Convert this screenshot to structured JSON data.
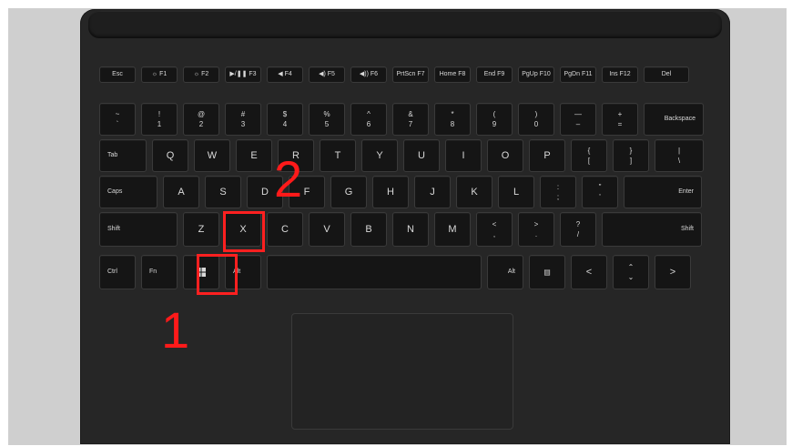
{
  "keyboard": {
    "rows": [
      [
        {
          "label": "Esc",
          "style": "fn-row",
          "w": 40
        },
        {
          "label": "☼ F1",
          "style": "fn-row",
          "w": 40
        },
        {
          "label": "☼ F2",
          "style": "fn-row",
          "w": 40
        },
        {
          "label": "▶/❚❚ F3",
          "style": "fn-row",
          "w": 40
        },
        {
          "label": "◀ F4",
          "style": "fn-row",
          "w": 40
        },
        {
          "label": "◀) F5",
          "style": "fn-row",
          "w": 40
        },
        {
          "label": "◀)) F6",
          "style": "fn-row",
          "w": 40
        },
        {
          "label": "PrtScn F7",
          "style": "fn-row",
          "w": 40
        },
        {
          "label": "Home F8",
          "style": "fn-row",
          "w": 40
        },
        {
          "label": "End F9",
          "style": "fn-row",
          "w": 40
        },
        {
          "label": "PgUp F10",
          "style": "fn-row",
          "w": 40
        },
        {
          "label": "PgDn F11",
          "style": "fn-row",
          "w": 40
        },
        {
          "label": "Ins F12",
          "style": "fn-row",
          "w": 40
        },
        {
          "label": "Del",
          "style": "fn-row",
          "w": 50
        }
      ],
      [
        {
          "label": "~\n`",
          "style": "two",
          "w": 40
        },
        {
          "label": "!\n1",
          "style": "two",
          "w": 40
        },
        {
          "label": "@\n2",
          "style": "two",
          "w": 40
        },
        {
          "label": "#\n3",
          "style": "two",
          "w": 40
        },
        {
          "label": "$\n4",
          "style": "two",
          "w": 40
        },
        {
          "label": "%\n5",
          "style": "two",
          "w": 40
        },
        {
          "label": "^\n6",
          "style": "two",
          "w": 40
        },
        {
          "label": "&\n7",
          "style": "two",
          "w": 40
        },
        {
          "label": "*\n8",
          "style": "two",
          "w": 40
        },
        {
          "label": "(\n9",
          "style": "two",
          "w": 40
        },
        {
          "label": ")\n0",
          "style": "two",
          "w": 40
        },
        {
          "label": "—\n–",
          "style": "two",
          "w": 40
        },
        {
          "label": "+\n=",
          "style": "two",
          "w": 40
        },
        {
          "label": "Backspace",
          "style": "mod right",
          "w": 66
        }
      ],
      [
        {
          "label": "Tab",
          "style": "mod",
          "w": 52
        },
        {
          "label": "Q",
          "style": "letter",
          "w": 40
        },
        {
          "label": "W",
          "style": "letter",
          "w": 40
        },
        {
          "label": "E",
          "style": "letter",
          "w": 40
        },
        {
          "label": "R",
          "style": "letter",
          "w": 40
        },
        {
          "label": "T",
          "style": "letter",
          "w": 40
        },
        {
          "label": "Y",
          "style": "letter",
          "w": 40
        },
        {
          "label": "U",
          "style": "letter",
          "w": 40
        },
        {
          "label": "I",
          "style": "letter",
          "w": 40
        },
        {
          "label": "O",
          "style": "letter",
          "w": 40
        },
        {
          "label": "P",
          "style": "letter",
          "w": 40
        },
        {
          "label": "{\n[",
          "style": "two",
          "w": 40
        },
        {
          "label": "}\n]",
          "style": "two",
          "w": 40
        },
        {
          "label": "|\n\\",
          "style": "two",
          "w": 54
        }
      ],
      [
        {
          "label": "Caps",
          "style": "mod",
          "w": 64
        },
        {
          "label": "A",
          "style": "letter",
          "w": 40
        },
        {
          "label": "S",
          "style": "letter",
          "w": 40
        },
        {
          "label": "D",
          "style": "letter",
          "w": 40
        },
        {
          "label": "F",
          "style": "letter",
          "w": 40
        },
        {
          "label": "G",
          "style": "letter",
          "w": 40
        },
        {
          "label": "H",
          "style": "letter",
          "w": 40
        },
        {
          "label": "J",
          "style": "letter",
          "w": 40
        },
        {
          "label": "K",
          "style": "letter",
          "w": 40
        },
        {
          "label": "L",
          "style": "letter",
          "w": 40
        },
        {
          "label": ":\n;",
          "style": "two",
          "w": 40
        },
        {
          "label": "\"\n'",
          "style": "two",
          "w": 40
        },
        {
          "label": "Enter",
          "style": "mod right",
          "w": 86
        }
      ],
      [
        {
          "label": "Shift",
          "style": "mod",
          "w": 86
        },
        {
          "label": "Z",
          "style": "letter",
          "w": 40
        },
        {
          "label": "X",
          "style": "letter",
          "w": 40
        },
        {
          "label": "C",
          "style": "letter",
          "w": 40
        },
        {
          "label": "V",
          "style": "letter",
          "w": 40
        },
        {
          "label": "B",
          "style": "letter",
          "w": 40
        },
        {
          "label": "N",
          "style": "letter",
          "w": 40
        },
        {
          "label": "M",
          "style": "letter",
          "w": 40
        },
        {
          "label": "<\n,",
          "style": "two",
          "w": 40
        },
        {
          "label": ">\n.",
          "style": "two",
          "w": 40
        },
        {
          "label": "?\n/",
          "style": "two",
          "w": 40
        },
        {
          "label": "Shift",
          "style": "mod right",
          "w": 110
        }
      ],
      [
        {
          "label": "Ctrl",
          "style": "mod",
          "w": 40
        },
        {
          "label": "Fn",
          "style": "mod",
          "w": 40
        },
        {
          "label": "",
          "style": "win",
          "w": 40
        },
        {
          "label": "Alt",
          "style": "mod",
          "w": 40
        },
        {
          "label": "",
          "style": "space",
          "w": 236
        },
        {
          "label": "Alt",
          "style": "mod right",
          "w": 40
        },
        {
          "label": "▤",
          "style": "two",
          "w": 40
        },
        {
          "label": "<",
          "style": "letter",
          "w": 40
        },
        {
          "label": "⌃\n⌄",
          "style": "two",
          "w": 40
        },
        {
          "label": ">",
          "style": "letter",
          "w": 40
        }
      ]
    ]
  },
  "annotations": [
    {
      "id": "1",
      "label": "1",
      "target": "Windows key"
    },
    {
      "id": "2",
      "label": "2",
      "target": "X key"
    }
  ],
  "colors": {
    "background": "#cfcfcf",
    "keyboard": "#262626",
    "highlight": "#ff2020"
  }
}
